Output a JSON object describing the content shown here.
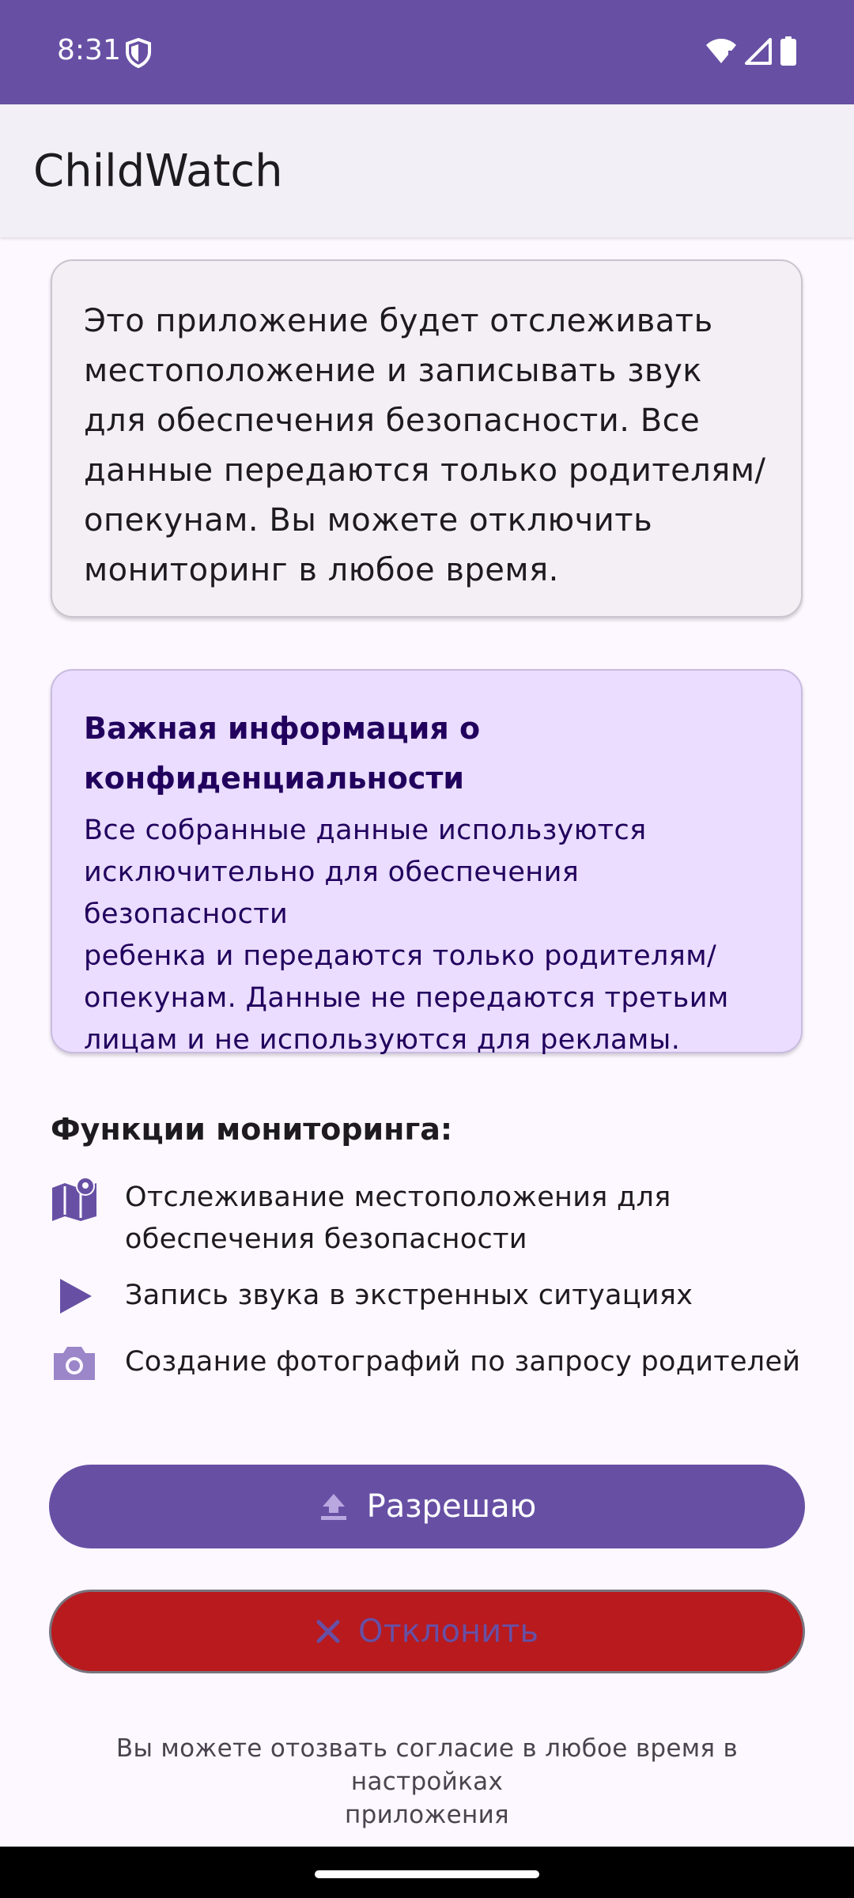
{
  "status_bar": {
    "time": "8:31",
    "icons": [
      "shield-icon",
      "wifi-icon",
      "signal-icon",
      "battery-icon"
    ]
  },
  "app_bar": {
    "title": "ChildWatch"
  },
  "info_card": {
    "lines": [
      "Это приложение будет отслеживать",
      "местоположение и записывать звук",
      "для обеспечения безопасности. Все",
      "данные передаются только родителям/",
      "опекунам. Вы можете отключить",
      "мониторинг в любое время."
    ]
  },
  "privacy_card": {
    "title_lines": [
      "Важная информация о",
      "конфиденциальности"
    ],
    "text_lines": [
      "Все собранные данные используются",
      "исключительно для обеспечения безопасности",
      "ребенка и передаются только родителям/",
      "опекунам. Данные не передаются третьим",
      "лицам и не используются для рекламы."
    ]
  },
  "features": {
    "title": "Функции мониторинга:",
    "items": [
      {
        "icon": "map-icon",
        "lines": [
          "Отслеживание местоположения для",
          "обеспечения безопасности"
        ]
      },
      {
        "icon": "play-icon",
        "lines": [
          "Запись звука в экстренных ситуациях"
        ]
      },
      {
        "icon": "camera-icon",
        "lines": [
          "Создание фотографий по запросу родителей"
        ]
      }
    ]
  },
  "buttons": {
    "accept_label": "Разрешаю",
    "accept_icon": "upload-icon",
    "decline_label": "Отклонить",
    "decline_icon": "close-icon"
  },
  "footer": {
    "lines": [
      "Вы можете отозвать согласие в любое время в настройках",
      "приложения"
    ]
  },
  "colors": {
    "primary": "#6750a4",
    "decline": "#b81a1e",
    "privacy_bg": "#eaddff",
    "info_bg": "#f3eff5"
  }
}
